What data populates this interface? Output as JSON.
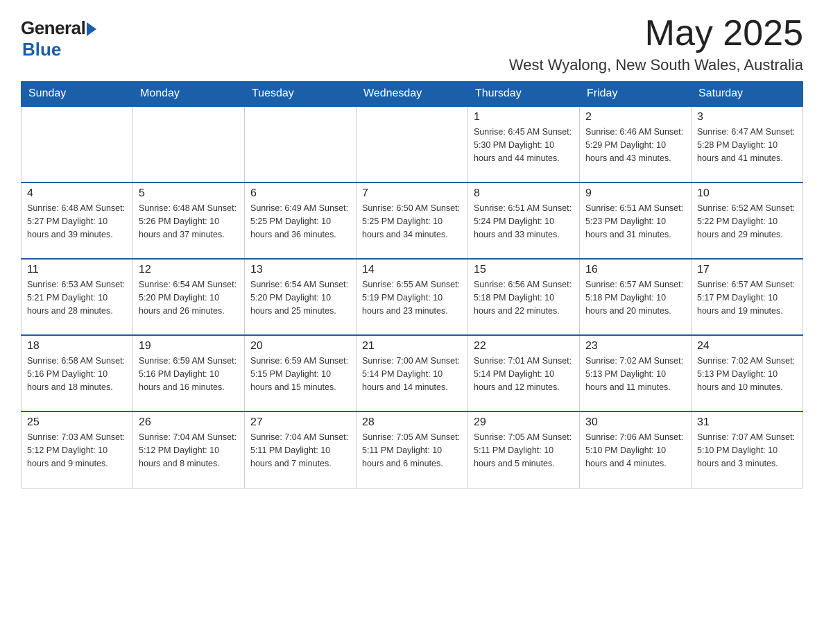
{
  "logo": {
    "general": "General",
    "blue": "Blue"
  },
  "title": {
    "month_year": "May 2025",
    "location": "West Wyalong, New South Wales, Australia"
  },
  "days_of_week": [
    "Sunday",
    "Monday",
    "Tuesday",
    "Wednesday",
    "Thursday",
    "Friday",
    "Saturday"
  ],
  "weeks": [
    [
      {
        "day": "",
        "info": ""
      },
      {
        "day": "",
        "info": ""
      },
      {
        "day": "",
        "info": ""
      },
      {
        "day": "",
        "info": ""
      },
      {
        "day": "1",
        "info": "Sunrise: 6:45 AM\nSunset: 5:30 PM\nDaylight: 10 hours\nand 44 minutes."
      },
      {
        "day": "2",
        "info": "Sunrise: 6:46 AM\nSunset: 5:29 PM\nDaylight: 10 hours\nand 43 minutes."
      },
      {
        "day": "3",
        "info": "Sunrise: 6:47 AM\nSunset: 5:28 PM\nDaylight: 10 hours\nand 41 minutes."
      }
    ],
    [
      {
        "day": "4",
        "info": "Sunrise: 6:48 AM\nSunset: 5:27 PM\nDaylight: 10 hours\nand 39 minutes."
      },
      {
        "day": "5",
        "info": "Sunrise: 6:48 AM\nSunset: 5:26 PM\nDaylight: 10 hours\nand 37 minutes."
      },
      {
        "day": "6",
        "info": "Sunrise: 6:49 AM\nSunset: 5:25 PM\nDaylight: 10 hours\nand 36 minutes."
      },
      {
        "day": "7",
        "info": "Sunrise: 6:50 AM\nSunset: 5:25 PM\nDaylight: 10 hours\nand 34 minutes."
      },
      {
        "day": "8",
        "info": "Sunrise: 6:51 AM\nSunset: 5:24 PM\nDaylight: 10 hours\nand 33 minutes."
      },
      {
        "day": "9",
        "info": "Sunrise: 6:51 AM\nSunset: 5:23 PM\nDaylight: 10 hours\nand 31 minutes."
      },
      {
        "day": "10",
        "info": "Sunrise: 6:52 AM\nSunset: 5:22 PM\nDaylight: 10 hours\nand 29 minutes."
      }
    ],
    [
      {
        "day": "11",
        "info": "Sunrise: 6:53 AM\nSunset: 5:21 PM\nDaylight: 10 hours\nand 28 minutes."
      },
      {
        "day": "12",
        "info": "Sunrise: 6:54 AM\nSunset: 5:20 PM\nDaylight: 10 hours\nand 26 minutes."
      },
      {
        "day": "13",
        "info": "Sunrise: 6:54 AM\nSunset: 5:20 PM\nDaylight: 10 hours\nand 25 minutes."
      },
      {
        "day": "14",
        "info": "Sunrise: 6:55 AM\nSunset: 5:19 PM\nDaylight: 10 hours\nand 23 minutes."
      },
      {
        "day": "15",
        "info": "Sunrise: 6:56 AM\nSunset: 5:18 PM\nDaylight: 10 hours\nand 22 minutes."
      },
      {
        "day": "16",
        "info": "Sunrise: 6:57 AM\nSunset: 5:18 PM\nDaylight: 10 hours\nand 20 minutes."
      },
      {
        "day": "17",
        "info": "Sunrise: 6:57 AM\nSunset: 5:17 PM\nDaylight: 10 hours\nand 19 minutes."
      }
    ],
    [
      {
        "day": "18",
        "info": "Sunrise: 6:58 AM\nSunset: 5:16 PM\nDaylight: 10 hours\nand 18 minutes."
      },
      {
        "day": "19",
        "info": "Sunrise: 6:59 AM\nSunset: 5:16 PM\nDaylight: 10 hours\nand 16 minutes."
      },
      {
        "day": "20",
        "info": "Sunrise: 6:59 AM\nSunset: 5:15 PM\nDaylight: 10 hours\nand 15 minutes."
      },
      {
        "day": "21",
        "info": "Sunrise: 7:00 AM\nSunset: 5:14 PM\nDaylight: 10 hours\nand 14 minutes."
      },
      {
        "day": "22",
        "info": "Sunrise: 7:01 AM\nSunset: 5:14 PM\nDaylight: 10 hours\nand 12 minutes."
      },
      {
        "day": "23",
        "info": "Sunrise: 7:02 AM\nSunset: 5:13 PM\nDaylight: 10 hours\nand 11 minutes."
      },
      {
        "day": "24",
        "info": "Sunrise: 7:02 AM\nSunset: 5:13 PM\nDaylight: 10 hours\nand 10 minutes."
      }
    ],
    [
      {
        "day": "25",
        "info": "Sunrise: 7:03 AM\nSunset: 5:12 PM\nDaylight: 10 hours\nand 9 minutes."
      },
      {
        "day": "26",
        "info": "Sunrise: 7:04 AM\nSunset: 5:12 PM\nDaylight: 10 hours\nand 8 minutes."
      },
      {
        "day": "27",
        "info": "Sunrise: 7:04 AM\nSunset: 5:11 PM\nDaylight: 10 hours\nand 7 minutes."
      },
      {
        "day": "28",
        "info": "Sunrise: 7:05 AM\nSunset: 5:11 PM\nDaylight: 10 hours\nand 6 minutes."
      },
      {
        "day": "29",
        "info": "Sunrise: 7:05 AM\nSunset: 5:11 PM\nDaylight: 10 hours\nand 5 minutes."
      },
      {
        "day": "30",
        "info": "Sunrise: 7:06 AM\nSunset: 5:10 PM\nDaylight: 10 hours\nand 4 minutes."
      },
      {
        "day": "31",
        "info": "Sunrise: 7:07 AM\nSunset: 5:10 PM\nDaylight: 10 hours\nand 3 minutes."
      }
    ]
  ]
}
